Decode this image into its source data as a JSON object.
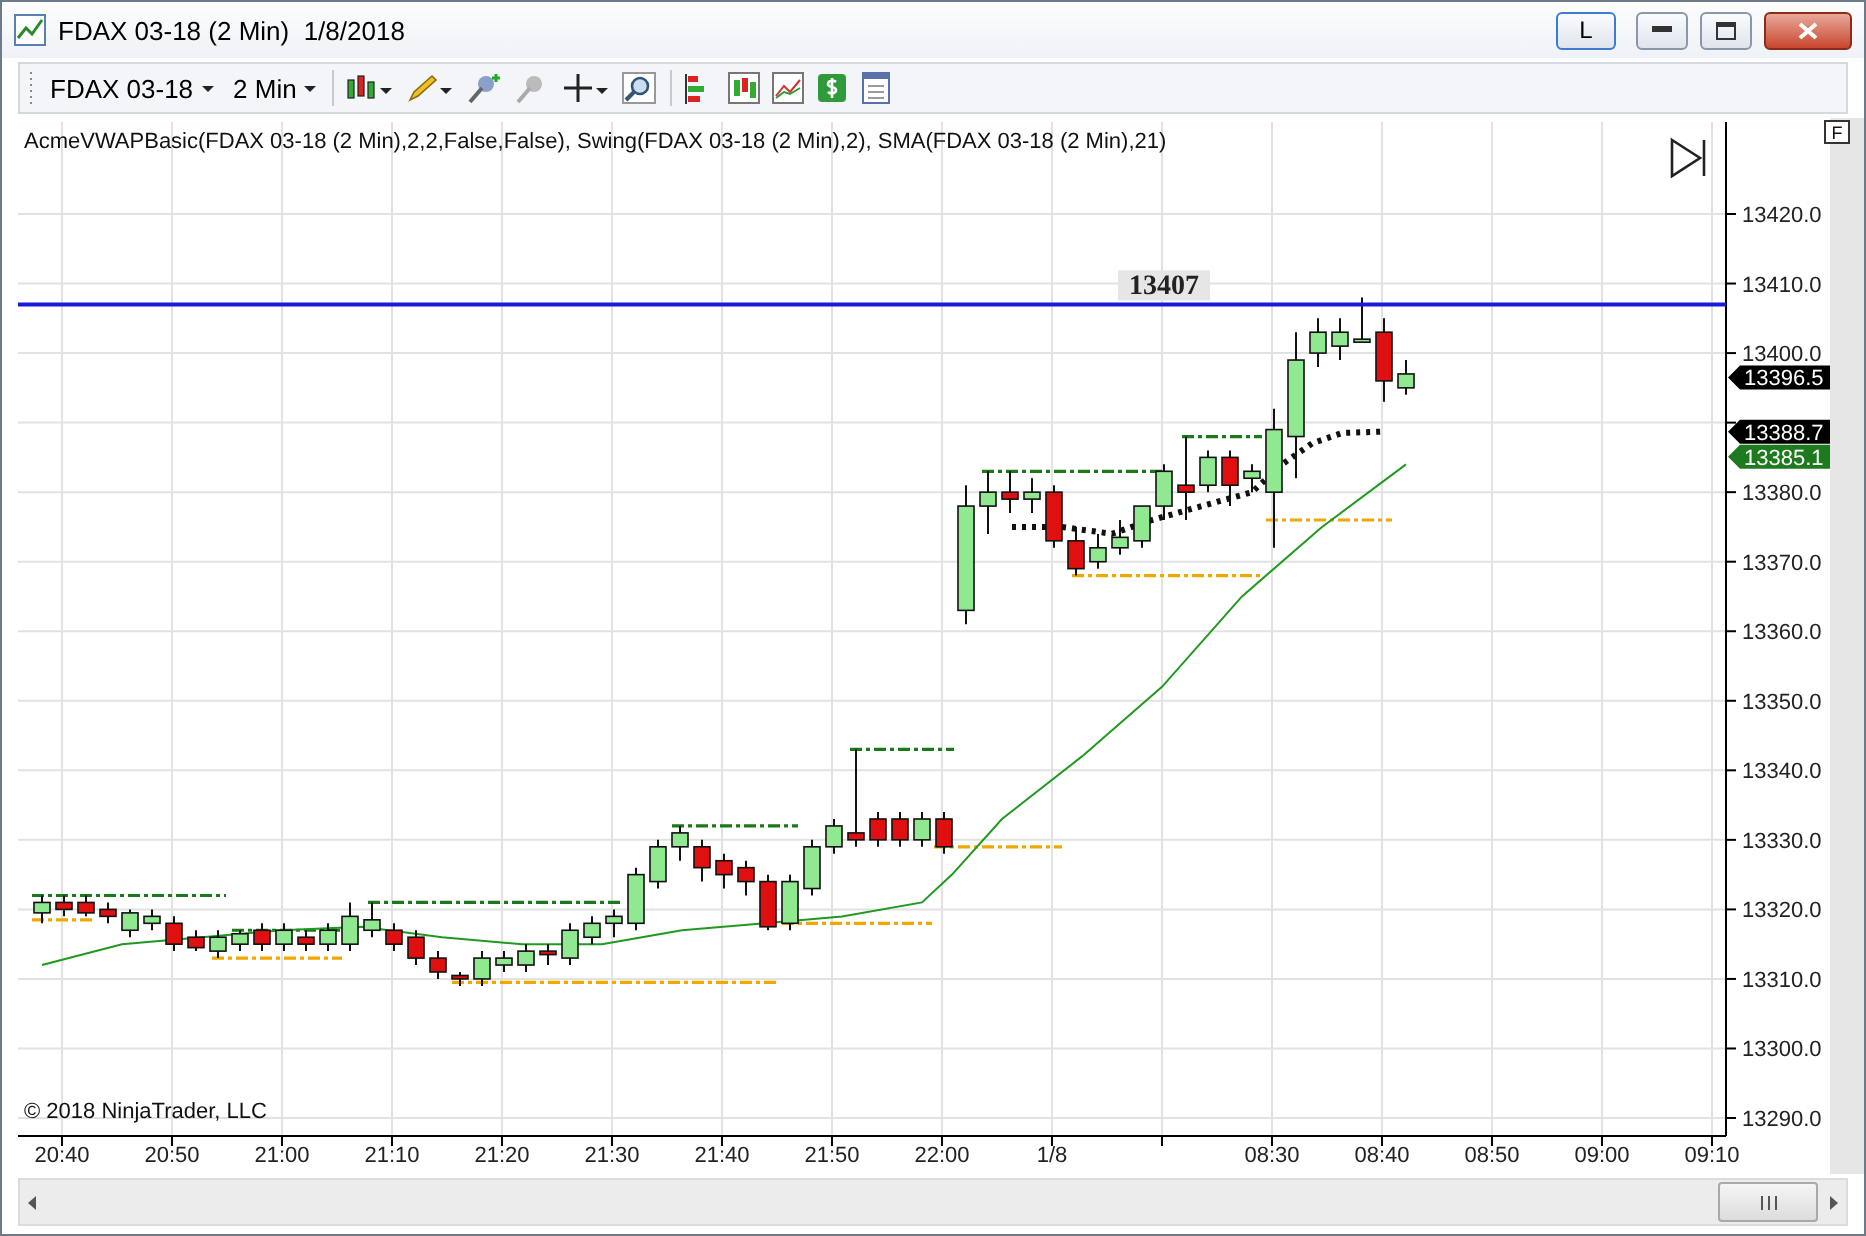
{
  "window": {
    "title": "FDAX 03-18 (2 Min)  1/8/2018",
    "link_button": "L"
  },
  "toolbar": {
    "instrument": "FDAX 03-18",
    "interval": "2 Min"
  },
  "chart": {
    "indicators": "AcmeVWAPBasic(FDAX 03-18 (2 Min),2,2,False,False), Swing(FDAX 03-18 (2 Min),2), SMA(FDAX 03-18 (2 Min),21)",
    "panel_label": "F",
    "reference_line": "13407",
    "price_axis": [
      "13420.0",
      "13410.0",
      "13400.0",
      "13380.0",
      "13370.0",
      "13360.0",
      "13350.0",
      "13340.0",
      "13330.0",
      "13320.0",
      "13310.0",
      "13300.0",
      "13290.0"
    ],
    "price_markers": [
      {
        "label": "13396.5",
        "color": "#000000"
      },
      {
        "label": "13388.7",
        "color": "#000000"
      },
      {
        "label": "13385.1",
        "color": "#1e7a1e"
      }
    ],
    "time_axis": [
      "20:40",
      "20:50",
      "21:00",
      "21:10",
      "21:20",
      "21:30",
      "21:40",
      "21:50",
      "22:00",
      "1/8",
      "08:30",
      "08:40",
      "08:50",
      "09:00",
      "09:10"
    ],
    "copyright": "© 2018 NinjaTrader, LLC"
  }
}
